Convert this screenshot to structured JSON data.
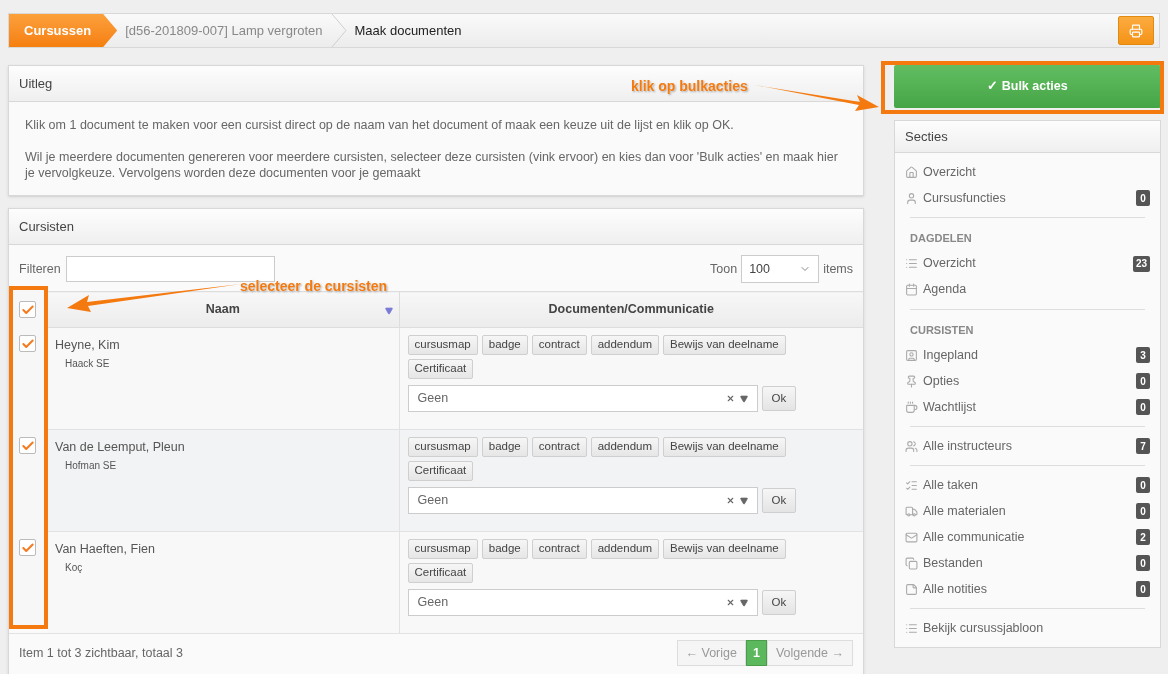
{
  "breadcrumb": [
    {
      "label": "Cursussen",
      "selected": true
    },
    {
      "label": "[d56-201809-007] Lamp vergroten",
      "selected": false
    },
    {
      "label": "Maak documenten",
      "selected": false
    }
  ],
  "uitleg": {
    "title": "Uitleg",
    "paragraphs": [
      "Klik om 1 document te maken voor een cursist direct op de naam van het document of maak een keuze uit de lijst en klik op OK.",
      "Wil je meerdere documenten genereren voor meerdere cursisten, selecteer deze cursisten (vink ervoor) en kies dan voor 'Bulk acties' en maak hier je vervolgkeuze. Vervolgens worden deze documenten voor je gemaakt"
    ]
  },
  "cursisten": {
    "title": "Cursisten",
    "filter_label": "Filteren",
    "show_label": "Toon",
    "page_size": "100",
    "items_label": "items",
    "columns": [
      "Naam",
      "Documenten/Communicatie"
    ],
    "all_checked": true,
    "rows": [
      {
        "checked": true,
        "name": "Heyne, Kim",
        "company": "Haack SE",
        "documents": [
          "cursusmap",
          "badge",
          "contract",
          "addendum",
          "Bewijs van deelname",
          "Certificaat"
        ],
        "select": "Geen",
        "ok": "Ok"
      },
      {
        "checked": true,
        "name": "Van de Leemput, Pleun",
        "company": "Hofman SE",
        "documents": [
          "cursusmap",
          "badge",
          "contract",
          "addendum",
          "Bewijs van deelname",
          "Certificaat"
        ],
        "select": "Geen",
        "ok": "Ok"
      },
      {
        "checked": true,
        "name": "Van Haeften, Fien",
        "company": "Koç",
        "documents": [
          "cursusmap",
          "badge",
          "contract",
          "addendum",
          "Bewijs van deelname",
          "Certificaat"
        ],
        "select": "Geen",
        "ok": "Ok"
      }
    ],
    "footer": "Item 1 tot 3 zichtbaar, totaal 3",
    "pagination": [
      {
        "label": "← Vorige",
        "selected": false
      },
      {
        "label": "1",
        "selected": true
      },
      {
        "label": "Volgende →",
        "selected": false
      }
    ]
  },
  "bulk_button": "✓ Bulk acties",
  "sidebar": {
    "title": "Secties",
    "groups": [
      {
        "items": [
          {
            "label": "Overzicht"
          },
          {
            "label": "Cursusfuncties",
            "count": "0"
          }
        ]
      },
      {
        "heading": "DAGDELEN",
        "items": [
          {
            "label": "Overzicht",
            "count": "23"
          },
          {
            "label": "Agenda"
          }
        ]
      },
      {
        "heading": "CURSISTEN",
        "items": [
          {
            "label": "Ingepland",
            "count": "3"
          },
          {
            "label": "Opties",
            "count": "0"
          },
          {
            "label": "Wachtlijst",
            "count": "0"
          }
        ]
      },
      {
        "items": [
          {
            "label": "Alle instructeurs",
            "count": "7"
          }
        ]
      },
      {
        "items": [
          {
            "label": "Alle taken",
            "count": "0"
          },
          {
            "label": "Alle materialen",
            "count": "0"
          },
          {
            "label": "Alle communicatie",
            "count": "2"
          },
          {
            "label": "Bestanden",
            "count": "0"
          },
          {
            "label": "Alle notities",
            "count": "0"
          }
        ]
      },
      {
        "items": [
          {
            "label": "Bekijk cursussjabloon"
          }
        ]
      }
    ]
  },
  "annotations": [
    "klik op bulkacties",
    "selecteer de cursisten"
  ]
}
